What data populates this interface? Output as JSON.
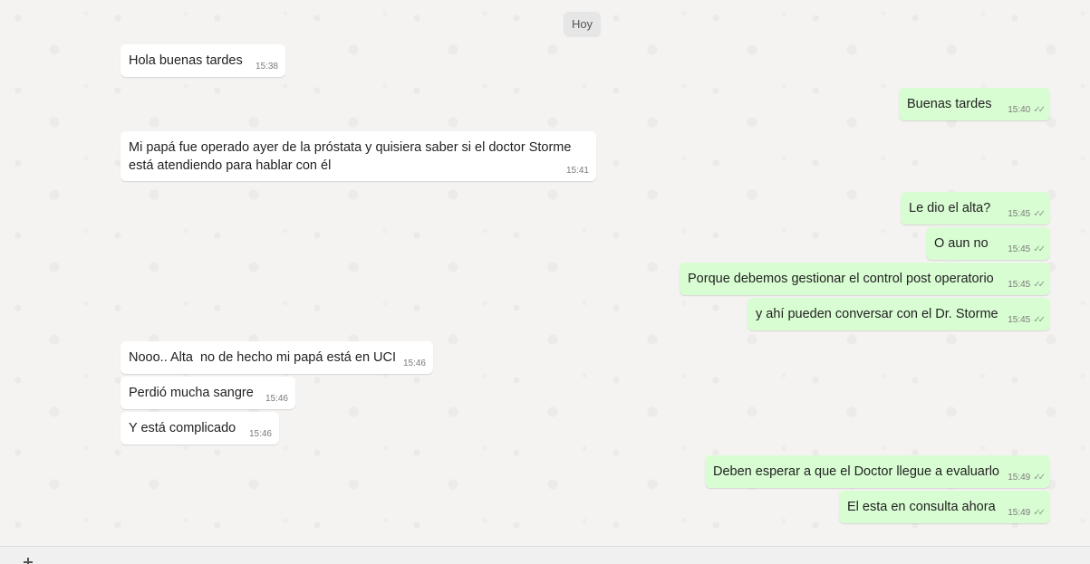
{
  "date_chip": "Hoy",
  "messages": [
    {
      "text": "Hola buenas tardes",
      "time": "15:38",
      "dir": "in"
    },
    {
      "text": "Buenas tardes",
      "time": "15:40",
      "dir": "out"
    },
    {
      "text": "Mi papá fue operado ayer de la próstata y quisiera saber si el doctor Storme está atendiendo para hablar con él",
      "time": "15:41",
      "dir": "in"
    },
    {
      "text": "Le dio el alta?",
      "time": "15:45",
      "dir": "out"
    },
    {
      "text": "O aun no",
      "time": "15:45",
      "dir": "out"
    },
    {
      "text": "Porque debemos gestionar el control post operatorio",
      "time": "15:45",
      "dir": "out"
    },
    {
      "text": "y ahí pueden conversar con el Dr. Storme",
      "time": "15:45",
      "dir": "out"
    },
    {
      "text": "Nooo.. Alta  no de hecho mi papá está en UCI",
      "time": "15:46",
      "dir": "in"
    },
    {
      "text": "Perdió mucha sangre",
      "time": "15:46",
      "dir": "in"
    },
    {
      "text": "Y está complicado",
      "time": "15:46",
      "dir": "in"
    },
    {
      "text": "Deben esperar a que el Doctor llegue a evaluarlo",
      "time": "15:49",
      "dir": "out"
    },
    {
      "text": "El esta en consulta ahora",
      "time": "15:49",
      "dir": "out"
    }
  ],
  "colors": {
    "incoming": "#ffffff",
    "outgoing": "#d9fdd3",
    "background": "#f4f3f1"
  },
  "icons": {
    "read_receipt": "double-check-icon",
    "attach": "plus-icon"
  }
}
